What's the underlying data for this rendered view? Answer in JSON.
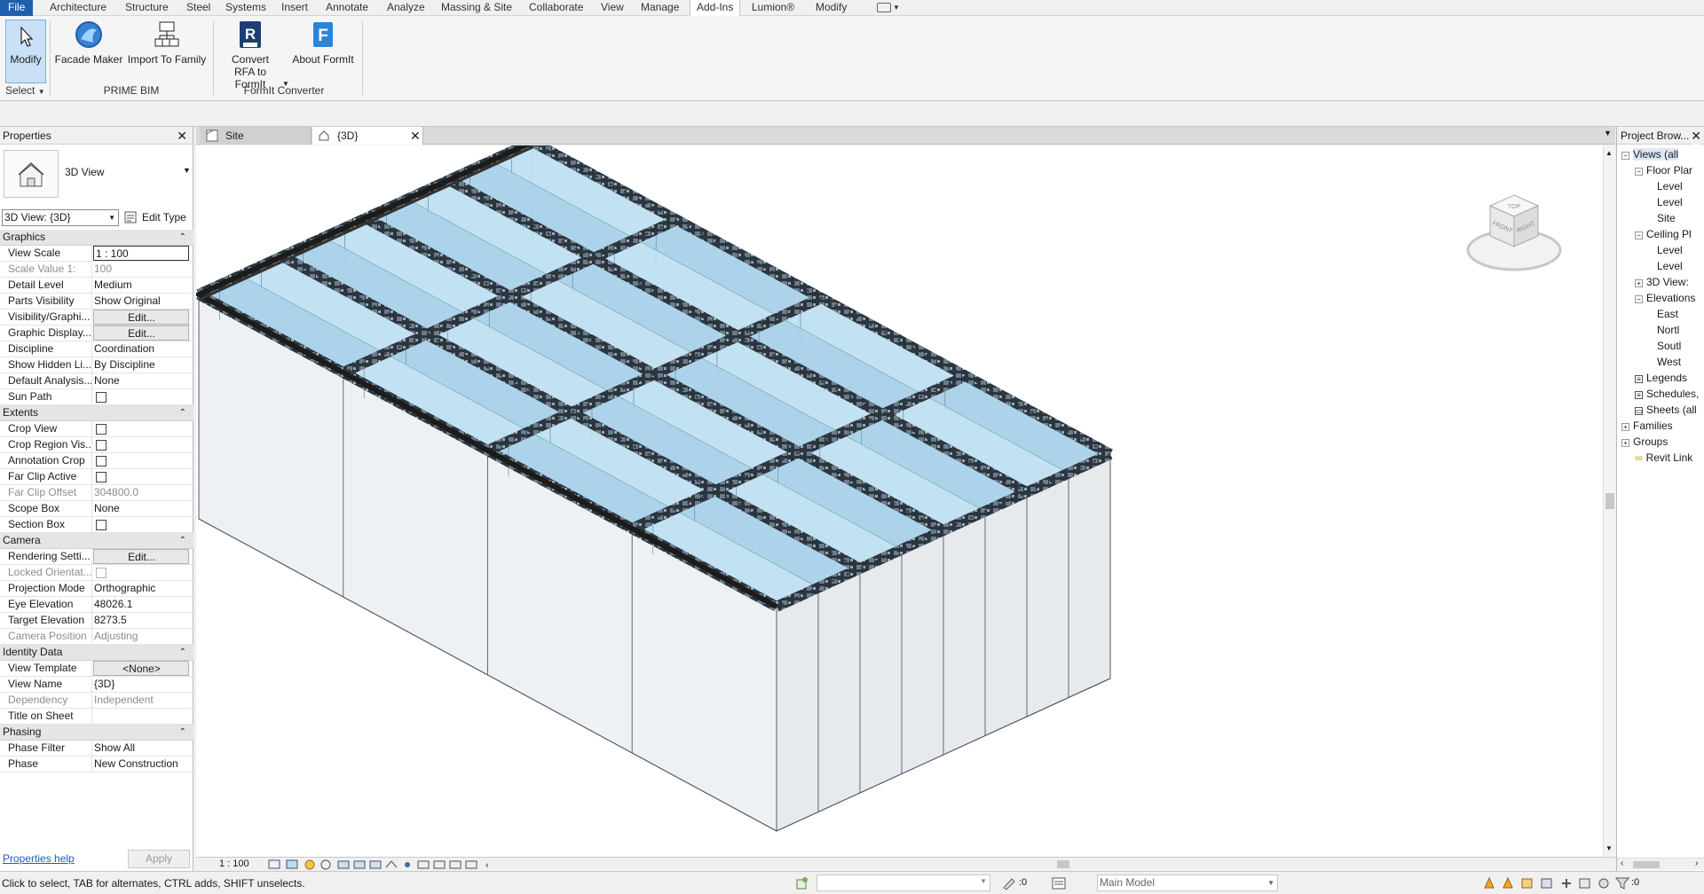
{
  "menu": {
    "file": "File",
    "tabs": [
      "Architecture",
      "Structure",
      "Steel",
      "Systems",
      "Insert",
      "Annotate",
      "Analyze",
      "Massing & Site",
      "Collaborate",
      "View",
      "Manage",
      "Add-Ins",
      "Lumion®",
      "Modify"
    ],
    "active_tab": "Add-Ins"
  },
  "ribbon": {
    "modify_label": "Modify",
    "select_label": "Select",
    "facade_maker": "Facade Maker",
    "import_to_family": "Import To Family",
    "prime_bim_panel": "PRIME BIM",
    "convert_rfa": "Convert RFA to FormIt",
    "about_formit": "About FormIt",
    "formit_panel": "FormIt Converter"
  },
  "properties": {
    "title": "Properties",
    "type_name": "3D View",
    "instance_selector": "3D View: {3D}",
    "edit_type": "Edit Type",
    "groups": {
      "graphics": "Graphics",
      "extents": "Extents",
      "camera": "Camera",
      "identity": "Identity Data",
      "phasing": "Phasing"
    },
    "rows": {
      "view_scale": {
        "k": "View Scale",
        "v": "1 : 100"
      },
      "scale_value": {
        "k": "Scale Value    1:",
        "v": "100"
      },
      "detail_level": {
        "k": "Detail Level",
        "v": "Medium"
      },
      "parts_visibility": {
        "k": "Parts Visibility",
        "v": "Show Original"
      },
      "vis_graphics": {
        "k": "Visibility/Graphi...",
        "v": "Edit..."
      },
      "graphic_display": {
        "k": "Graphic Display...",
        "v": "Edit..."
      },
      "discipline": {
        "k": "Discipline",
        "v": "Coordination"
      },
      "show_hidden": {
        "k": "Show Hidden Li...",
        "v": "By Discipline"
      },
      "default_analysis": {
        "k": "Default Analysis...",
        "v": "None"
      },
      "sun_path": {
        "k": "Sun Path"
      },
      "crop_view": {
        "k": "Crop View"
      },
      "crop_region": {
        "k": "Crop Region Vis..."
      },
      "annotation_crop": {
        "k": "Annotation Crop"
      },
      "far_clip_active": {
        "k": "Far Clip Active"
      },
      "far_clip_offset": {
        "k": "Far Clip Offset",
        "v": "304800.0"
      },
      "scope_box": {
        "k": "Scope Box",
        "v": "None"
      },
      "section_box": {
        "k": "Section Box"
      },
      "rendering": {
        "k": "Rendering Setti...",
        "v": "Edit..."
      },
      "locked_orient": {
        "k": "Locked Orientat..."
      },
      "projection": {
        "k": "Projection Mode",
        "v": "Orthographic"
      },
      "eye_elev": {
        "k": "Eye Elevation",
        "v": "48026.1"
      },
      "target_elev": {
        "k": "Target Elevation",
        "v": "8273.5"
      },
      "camera_pos": {
        "k": "Camera Position",
        "v": "Adjusting"
      },
      "view_template": {
        "k": "View Template",
        "v": "<None>"
      },
      "view_name": {
        "k": "View Name",
        "v": "{3D}"
      },
      "dependency": {
        "k": "Dependency",
        "v": "Independent"
      },
      "title_on_sheet": {
        "k": "Title on Sheet",
        "v": ""
      },
      "phase_filter": {
        "k": "Phase Filter",
        "v": "Show All"
      },
      "phase": {
        "k": "Phase",
        "v": "New Construction"
      }
    },
    "help": "Properties help",
    "apply": "Apply"
  },
  "view_tabs": [
    {
      "label": "Site"
    },
    {
      "label": "{3D}"
    }
  ],
  "viewcube": {
    "top": "TOP",
    "front": "FRONT",
    "right": "RIGHT"
  },
  "view_bar": {
    "scale": "1 : 100"
  },
  "browser": {
    "title": "Project Brow...",
    "items": [
      "Views (all",
      "Floor Plar",
      "Level",
      "Level",
      "Site",
      "Ceiling Pl",
      "Level",
      "Level",
      "3D View:",
      "Elevations",
      "East",
      "Nortl",
      "Soutl",
      "West",
      "Legends",
      "Schedules,",
      "Sheets (all",
      "Families",
      "Groups",
      "Revit Link"
    ]
  },
  "status": {
    "message": "Click to select, TAB for alternates, CTRL adds, SHIFT unselects.",
    "zero1": ":0",
    "model": "Main Model",
    "zero2": ":0"
  },
  "colors": {
    "accent": "#1f5fae",
    "glass": "#bfe0f2",
    "frame": "#2a3440",
    "highlight": "#c9e0f7"
  }
}
